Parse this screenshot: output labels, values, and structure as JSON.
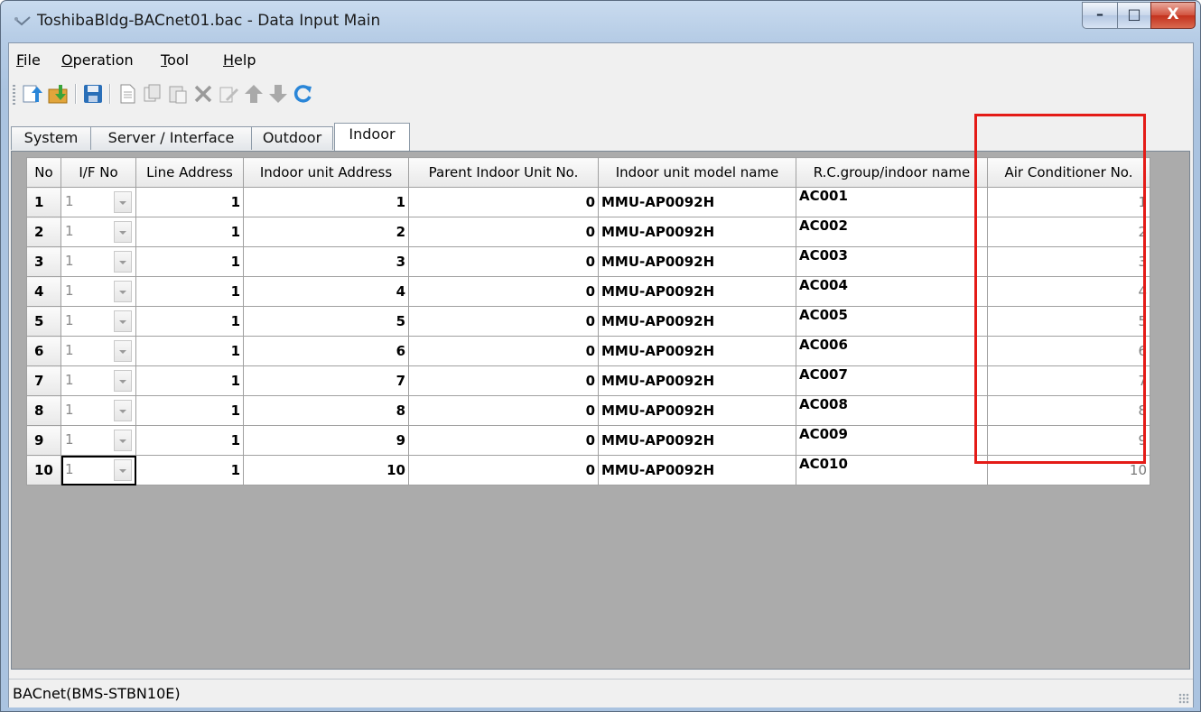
{
  "window": {
    "title": "ToshibaBldg-BACnet01.bac - Data Input Main",
    "controls": {
      "minimize": "–",
      "maximize": "□",
      "close": "X"
    }
  },
  "menu": [
    {
      "label": "File",
      "accesskey": "F",
      "rest": "ile"
    },
    {
      "label": "Operation",
      "accesskey": "O",
      "rest": "peration"
    },
    {
      "label": "Tool",
      "accesskey": "T",
      "rest": "ool"
    },
    {
      "label": "Help",
      "accesskey": "H",
      "rest": "elp"
    }
  ],
  "toolbar": {
    "icons": [
      "import-icon",
      "export-icon",
      "save-icon",
      "new-icon",
      "copy-icon",
      "paste-icon",
      "delete-icon",
      "edit-icon",
      "move-up-icon",
      "move-down-icon",
      "refresh-icon"
    ]
  },
  "tabs": [
    {
      "label": "System",
      "active": false
    },
    {
      "label": "Server / Interface",
      "active": false
    },
    {
      "label": "Outdoor",
      "active": false
    },
    {
      "label": "Indoor",
      "active": true
    }
  ],
  "grid": {
    "columns": [
      "No",
      "I/F No",
      "Line Address",
      "Indoor unit Address",
      "Parent Indoor Unit No.",
      "Indoor unit model name",
      "R.C.group/indoor name",
      "Air Conditioner No."
    ],
    "rows": [
      {
        "no": "1",
        "if_no": "1",
        "line": "1",
        "unit_addr": "1",
        "parent": "0",
        "model": "MMU-AP0092H",
        "name": "AC001",
        "ac_no": "1"
      },
      {
        "no": "2",
        "if_no": "1",
        "line": "1",
        "unit_addr": "2",
        "parent": "0",
        "model": "MMU-AP0092H",
        "name": "AC002",
        "ac_no": "2"
      },
      {
        "no": "3",
        "if_no": "1",
        "line": "1",
        "unit_addr": "3",
        "parent": "0",
        "model": "MMU-AP0092H",
        "name": "AC003",
        "ac_no": "3"
      },
      {
        "no": "4",
        "if_no": "1",
        "line": "1",
        "unit_addr": "4",
        "parent": "0",
        "model": "MMU-AP0092H",
        "name": "AC004",
        "ac_no": "4"
      },
      {
        "no": "5",
        "if_no": "1",
        "line": "1",
        "unit_addr": "5",
        "parent": "0",
        "model": "MMU-AP0092H",
        "name": "AC005",
        "ac_no": "5"
      },
      {
        "no": "6",
        "if_no": "1",
        "line": "1",
        "unit_addr": "6",
        "parent": "0",
        "model": "MMU-AP0092H",
        "name": "AC006",
        "ac_no": "6"
      },
      {
        "no": "7",
        "if_no": "1",
        "line": "1",
        "unit_addr": "7",
        "parent": "0",
        "model": "MMU-AP0092H",
        "name": "AC007",
        "ac_no": "7"
      },
      {
        "no": "8",
        "if_no": "1",
        "line": "1",
        "unit_addr": "8",
        "parent": "0",
        "model": "MMU-AP0092H",
        "name": "AC008",
        "ac_no": "8"
      },
      {
        "no": "9",
        "if_no": "1",
        "line": "1",
        "unit_addr": "9",
        "parent": "0",
        "model": "MMU-AP0092H",
        "name": "AC009",
        "ac_no": "9"
      },
      {
        "no": "10",
        "if_no": "1",
        "line": "1",
        "unit_addr": "10",
        "parent": "0",
        "model": "MMU-AP0092H",
        "name": "AC010",
        "ac_no": "10"
      }
    ],
    "current_row": 9
  },
  "highlight_color": "#e41b17",
  "status": {
    "text": "BACnet(BMS-STBN10E)"
  }
}
